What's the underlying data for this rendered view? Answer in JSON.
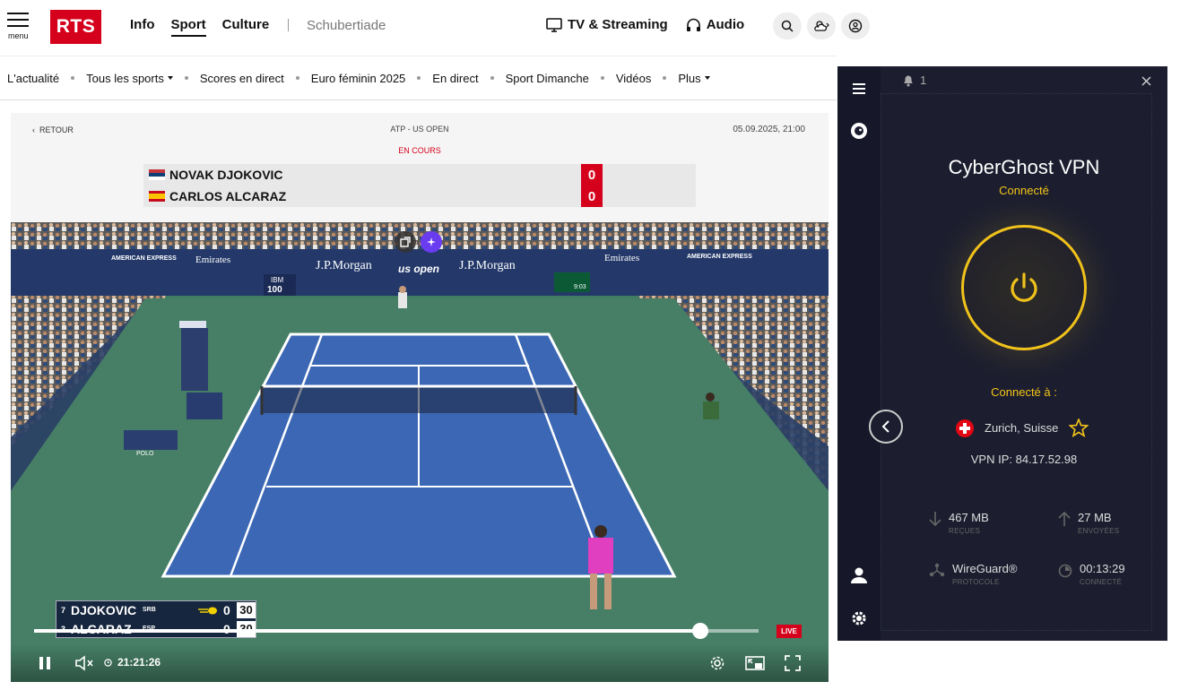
{
  "header": {
    "menu_label": "menu",
    "logo": "RTS",
    "nav": [
      "Info",
      "Sport",
      "Culture"
    ],
    "active_nav": "Sport",
    "extra": "Schubertiade",
    "tv_label": "TV & Streaming",
    "audio_label": "Audio",
    "icons": [
      "search-icon",
      "weather-icon",
      "account-icon"
    ]
  },
  "subnav": {
    "items": [
      "L'actualité",
      "Tous les sports",
      "Scores en direct",
      "Euro féminin 2025",
      "En direct",
      "Sport Dimanche",
      "Vidéos",
      "Plus"
    ]
  },
  "match": {
    "back_label": "RETOUR",
    "competition": "ATP - US OPEN",
    "datetime": "05.09.2025, 21:00",
    "status": "EN COURS",
    "players": [
      {
        "name": "NOVAK DJOKOVIC",
        "score": "0",
        "flag": "serbia"
      },
      {
        "name": "CARLOS ALCARAZ",
        "score": "0",
        "flag": "spain"
      }
    ]
  },
  "video": {
    "scene_texts": {
      "ad_amex": "AMERICAN EXPRESS",
      "ad_emirates": "Emirates",
      "ad_jpm": "J.P.Morgan",
      "ad_usopen": "us open",
      "ad_ibm": "IBM",
      "ad_ibm_speed": "100",
      "ad_rolex_time": "9:03",
      "ad_polo": "POLO"
    },
    "tv_score": [
      {
        "seed": "7",
        "name": "DJOKOVIC",
        "country": "SRB",
        "games": "0",
        "points": "30"
      },
      {
        "seed": "3",
        "name": "ALCARAZ",
        "country": "ESP",
        "games": "0",
        "points": "30"
      }
    ],
    "progress": 0.92,
    "live_label": "LIVE",
    "time": "21:21:26"
  },
  "vpn": {
    "notifications": "1",
    "title": "CyberGhost VPN",
    "state": "Connecté",
    "connected_to_label": "Connecté à :",
    "location": "Zurich, Suisse",
    "ip": "VPN IP: 84.17.52.98",
    "stats": [
      {
        "value": "467 MB",
        "label": "REÇUES",
        "icon": "download-icon"
      },
      {
        "value": "27 MB",
        "label": "ENVOYÉES",
        "icon": "upload-icon"
      },
      {
        "value": "WireGuard®",
        "label": "PROTOCOLE",
        "icon": "protocol-icon"
      },
      {
        "value": "00:13:29",
        "label": "CONNECTÉ",
        "icon": "timer-icon"
      }
    ],
    "colors": {
      "accent": "#f5c518",
      "panel": "#1c1e2f"
    }
  }
}
